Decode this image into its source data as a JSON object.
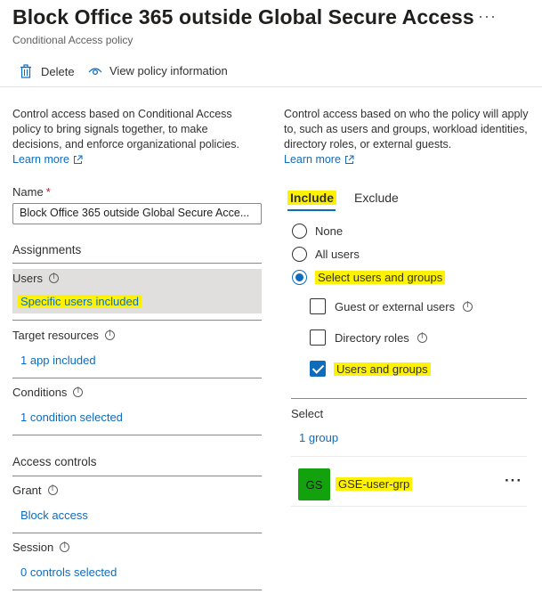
{
  "header": {
    "title": "Block Office 365 outside Global Secure Access",
    "more_label": "···",
    "subtitle": "Conditional Access policy"
  },
  "toolbar": {
    "delete_label": "Delete",
    "view_info_label": "View policy information"
  },
  "left": {
    "description": "Control access based on Conditional Access policy to bring signals together, to make decisions, and enforce organizational policies.",
    "learn_more": "Learn more",
    "name_label": "Name",
    "required_mark": "*",
    "name_value": "Block Office 365 outside Global Secure Acce...",
    "assignments_heading": "Assignments",
    "users_label": "Users",
    "users_value": "Specific users included",
    "target_label": "Target resources",
    "target_value": "1 app included",
    "conditions_label": "Conditions",
    "conditions_value": "1 condition selected",
    "access_controls_heading": "Access controls",
    "grant_label": "Grant",
    "grant_value": "Block access",
    "session_label": "Session",
    "session_value": "0 controls selected"
  },
  "right": {
    "description": "Control access based on who the policy will apply to, such as users and groups, workload identities, directory roles, or external guests.",
    "learn_more": "Learn more",
    "tabs": [
      {
        "label": "Include",
        "selected": true
      },
      {
        "label": "Exclude",
        "selected": false
      }
    ],
    "radios": [
      {
        "label": "None",
        "selected": false
      },
      {
        "label": "All users",
        "selected": false
      },
      {
        "label": "Select users and groups",
        "selected": true
      }
    ],
    "checkboxes": [
      {
        "label": "Guest or external users",
        "checked": false
      },
      {
        "label": "Directory roles",
        "checked": false
      },
      {
        "label": "Users and groups",
        "checked": true
      }
    ],
    "select_label": "Select",
    "select_value": "1 group",
    "group": {
      "initials": "GS",
      "name": "GSE-user-grp",
      "more_label": "···"
    }
  },
  "colors": {
    "accent": "#0f6cbd",
    "highlight": "#fff200",
    "avatar": "#13a10e",
    "users_box": "#e1dfdd"
  }
}
